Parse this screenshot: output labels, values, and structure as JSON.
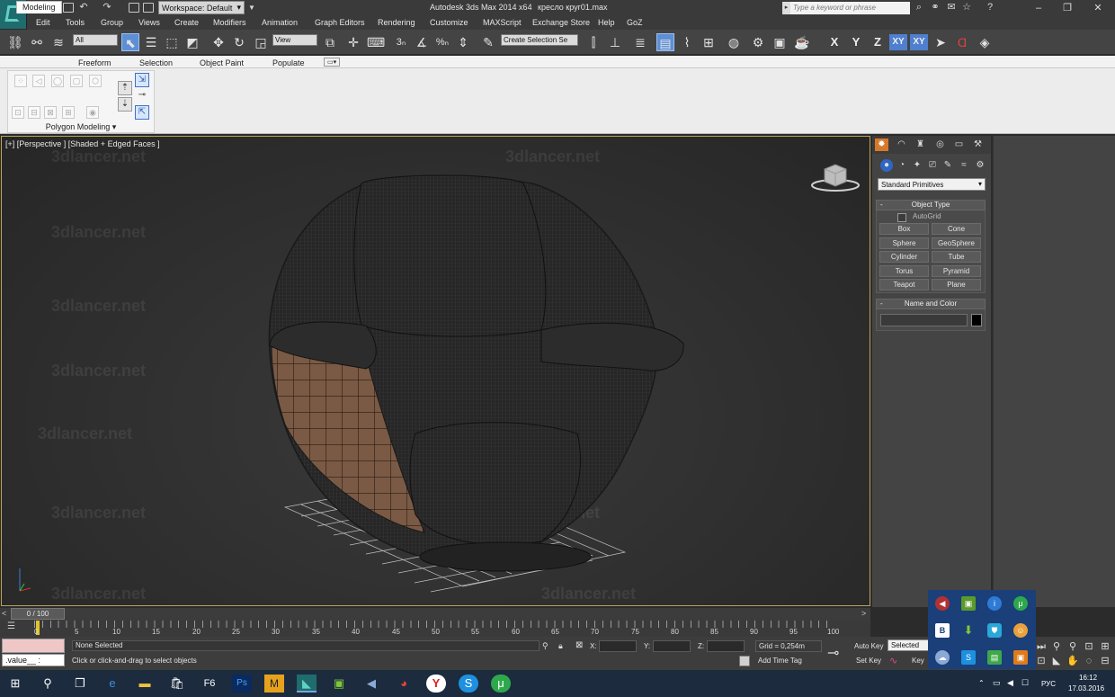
{
  "titlebar": {
    "workspace": "Workspace: Default",
    "app_title": "Autodesk 3ds Max  2014 x64",
    "document": "кресло круг01.max",
    "search_placeholder": "Type a keyword or phrase"
  },
  "menu": [
    "Edit",
    "Tools",
    "Group",
    "Views",
    "Create",
    "Modifiers",
    "Animation",
    "Graph Editors",
    "Rendering",
    "Customize",
    "MAXScript",
    "Exchange Store",
    "Help",
    "GoZ"
  ],
  "toolbar": {
    "selection_filter": "All",
    "ref_coord": "View",
    "named_selection": "Create Selection Se",
    "axes": [
      "X",
      "Y",
      "Z",
      "XY",
      "XY"
    ]
  },
  "ribbon": {
    "tabs": [
      "Modeling",
      "Freeform",
      "Selection",
      "Object Paint",
      "Populate"
    ],
    "active_tab": "Modeling",
    "panel_label": "Polygon Modeling"
  },
  "viewport": {
    "label": "[+] [Perspective ] [Shaded + Edged Faces ]",
    "watermark": "3dlancer.net"
  },
  "command_panel": {
    "category": "Standard Primitives",
    "object_type_title": "Object Type",
    "autogrid": "AutoGrid",
    "primitives": [
      "Box",
      "Cone",
      "Sphere",
      "GeoSphere",
      "Cylinder",
      "Tube",
      "Torus",
      "Pyramid",
      "Teapot",
      "Plane"
    ],
    "name_color_title": "Name and Color",
    "swatch_color": "#000000"
  },
  "timeline": {
    "frame": "0 / 100",
    "ticks": [
      "0",
      "5",
      "10",
      "15",
      "20",
      "25",
      "30",
      "35",
      "40",
      "45",
      "50",
      "55",
      "60",
      "65",
      "70",
      "75",
      "80",
      "85",
      "90",
      "95",
      "100"
    ]
  },
  "status": {
    "listener_text": ".value__ :",
    "selection": "None Selected",
    "prompt": "Click or click-and-drag to select objects",
    "x_label": "X:",
    "y_label": "Y:",
    "z_label": "Z:",
    "grid": "Grid = 0,254m",
    "add_time_tag": "Add Time Tag",
    "auto_key": "Auto Key",
    "selected": "Selected",
    "set_key": "Set Key",
    "key": "Key"
  },
  "taskbar": {
    "lang": "РУС",
    "time": "16:12",
    "date": "17.03.2016"
  },
  "colors": {
    "accent": "#5d8fd6",
    "viewport_border": "#b9a45a",
    "active_tab_orange": "#d7782b",
    "taskbar": "#1c2b3e",
    "tray_popup": "#1b3f78"
  }
}
